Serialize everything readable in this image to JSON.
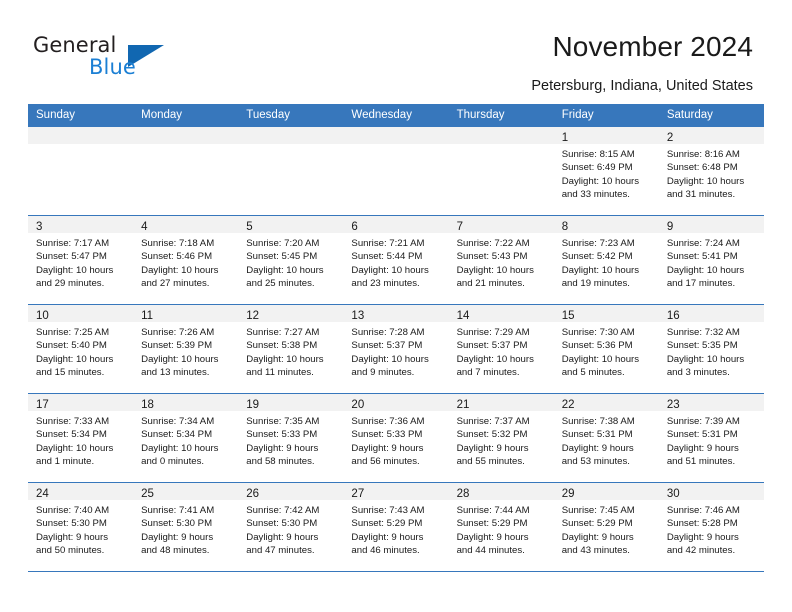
{
  "logo": {
    "word1": "General",
    "word2": "Blue",
    "triangle_color": "#1167b1",
    "blue_color": "#1b7fd4"
  },
  "header": {
    "title": "November 2024",
    "subtitle": "Petersburg, Indiana, United States"
  },
  "theme": {
    "header_blue": "#3777bc",
    "band_gray": "#f2f2f2",
    "text": "#1a1a1a"
  },
  "calendar": {
    "weekday_headers": [
      "Sunday",
      "Monday",
      "Tuesday",
      "Wednesday",
      "Thursday",
      "Friday",
      "Saturday"
    ],
    "labels": {
      "sunrise": "Sunrise:",
      "sunset": "Sunset:",
      "daylight": "Daylight:"
    },
    "weeks": [
      [
        {
          "day": "",
          "empty": true
        },
        {
          "day": "",
          "empty": true
        },
        {
          "day": "",
          "empty": true
        },
        {
          "day": "",
          "empty": true
        },
        {
          "day": "",
          "empty": true
        },
        {
          "day": "1",
          "sunrise": "Sunrise: 8:15 AM",
          "sunset": "Sunset: 6:49 PM",
          "daylight1": "Daylight: 10 hours",
          "daylight2": "and 33 minutes."
        },
        {
          "day": "2",
          "sunrise": "Sunrise: 8:16 AM",
          "sunset": "Sunset: 6:48 PM",
          "daylight1": "Daylight: 10 hours",
          "daylight2": "and 31 minutes."
        }
      ],
      [
        {
          "day": "3",
          "sunrise": "Sunrise: 7:17 AM",
          "sunset": "Sunset: 5:47 PM",
          "daylight1": "Daylight: 10 hours",
          "daylight2": "and 29 minutes."
        },
        {
          "day": "4",
          "sunrise": "Sunrise: 7:18 AM",
          "sunset": "Sunset: 5:46 PM",
          "daylight1": "Daylight: 10 hours",
          "daylight2": "and 27 minutes."
        },
        {
          "day": "5",
          "sunrise": "Sunrise: 7:20 AM",
          "sunset": "Sunset: 5:45 PM",
          "daylight1": "Daylight: 10 hours",
          "daylight2": "and 25 minutes."
        },
        {
          "day": "6",
          "sunrise": "Sunrise: 7:21 AM",
          "sunset": "Sunset: 5:44 PM",
          "daylight1": "Daylight: 10 hours",
          "daylight2": "and 23 minutes."
        },
        {
          "day": "7",
          "sunrise": "Sunrise: 7:22 AM",
          "sunset": "Sunset: 5:43 PM",
          "daylight1": "Daylight: 10 hours",
          "daylight2": "and 21 minutes."
        },
        {
          "day": "8",
          "sunrise": "Sunrise: 7:23 AM",
          "sunset": "Sunset: 5:42 PM",
          "daylight1": "Daylight: 10 hours",
          "daylight2": "and 19 minutes."
        },
        {
          "day": "9",
          "sunrise": "Sunrise: 7:24 AM",
          "sunset": "Sunset: 5:41 PM",
          "daylight1": "Daylight: 10 hours",
          "daylight2": "and 17 minutes."
        }
      ],
      [
        {
          "day": "10",
          "sunrise": "Sunrise: 7:25 AM",
          "sunset": "Sunset: 5:40 PM",
          "daylight1": "Daylight: 10 hours",
          "daylight2": "and 15 minutes."
        },
        {
          "day": "11",
          "sunrise": "Sunrise: 7:26 AM",
          "sunset": "Sunset: 5:39 PM",
          "daylight1": "Daylight: 10 hours",
          "daylight2": "and 13 minutes."
        },
        {
          "day": "12",
          "sunrise": "Sunrise: 7:27 AM",
          "sunset": "Sunset: 5:38 PM",
          "daylight1": "Daylight: 10 hours",
          "daylight2": "and 11 minutes."
        },
        {
          "day": "13",
          "sunrise": "Sunrise: 7:28 AM",
          "sunset": "Sunset: 5:37 PM",
          "daylight1": "Daylight: 10 hours",
          "daylight2": "and 9 minutes."
        },
        {
          "day": "14",
          "sunrise": "Sunrise: 7:29 AM",
          "sunset": "Sunset: 5:37 PM",
          "daylight1": "Daylight: 10 hours",
          "daylight2": "and 7 minutes."
        },
        {
          "day": "15",
          "sunrise": "Sunrise: 7:30 AM",
          "sunset": "Sunset: 5:36 PM",
          "daylight1": "Daylight: 10 hours",
          "daylight2": "and 5 minutes."
        },
        {
          "day": "16",
          "sunrise": "Sunrise: 7:32 AM",
          "sunset": "Sunset: 5:35 PM",
          "daylight1": "Daylight: 10 hours",
          "daylight2": "and 3 minutes."
        }
      ],
      [
        {
          "day": "17",
          "sunrise": "Sunrise: 7:33 AM",
          "sunset": "Sunset: 5:34 PM",
          "daylight1": "Daylight: 10 hours",
          "daylight2": "and 1 minute."
        },
        {
          "day": "18",
          "sunrise": "Sunrise: 7:34 AM",
          "sunset": "Sunset: 5:34 PM",
          "daylight1": "Daylight: 10 hours",
          "daylight2": "and 0 minutes."
        },
        {
          "day": "19",
          "sunrise": "Sunrise: 7:35 AM",
          "sunset": "Sunset: 5:33 PM",
          "daylight1": "Daylight: 9 hours",
          "daylight2": "and 58 minutes."
        },
        {
          "day": "20",
          "sunrise": "Sunrise: 7:36 AM",
          "sunset": "Sunset: 5:33 PM",
          "daylight1": "Daylight: 9 hours",
          "daylight2": "and 56 minutes."
        },
        {
          "day": "21",
          "sunrise": "Sunrise: 7:37 AM",
          "sunset": "Sunset: 5:32 PM",
          "daylight1": "Daylight: 9 hours",
          "daylight2": "and 55 minutes."
        },
        {
          "day": "22",
          "sunrise": "Sunrise: 7:38 AM",
          "sunset": "Sunset: 5:31 PM",
          "daylight1": "Daylight: 9 hours",
          "daylight2": "and 53 minutes."
        },
        {
          "day": "23",
          "sunrise": "Sunrise: 7:39 AM",
          "sunset": "Sunset: 5:31 PM",
          "daylight1": "Daylight: 9 hours",
          "daylight2": "and 51 minutes."
        }
      ],
      [
        {
          "day": "24",
          "sunrise": "Sunrise: 7:40 AM",
          "sunset": "Sunset: 5:30 PM",
          "daylight1": "Daylight: 9 hours",
          "daylight2": "and 50 minutes."
        },
        {
          "day": "25",
          "sunrise": "Sunrise: 7:41 AM",
          "sunset": "Sunset: 5:30 PM",
          "daylight1": "Daylight: 9 hours",
          "daylight2": "and 48 minutes."
        },
        {
          "day": "26",
          "sunrise": "Sunrise: 7:42 AM",
          "sunset": "Sunset: 5:30 PM",
          "daylight1": "Daylight: 9 hours",
          "daylight2": "and 47 minutes."
        },
        {
          "day": "27",
          "sunrise": "Sunrise: 7:43 AM",
          "sunset": "Sunset: 5:29 PM",
          "daylight1": "Daylight: 9 hours",
          "daylight2": "and 46 minutes."
        },
        {
          "day": "28",
          "sunrise": "Sunrise: 7:44 AM",
          "sunset": "Sunset: 5:29 PM",
          "daylight1": "Daylight: 9 hours",
          "daylight2": "and 44 minutes."
        },
        {
          "day": "29",
          "sunrise": "Sunrise: 7:45 AM",
          "sunset": "Sunset: 5:29 PM",
          "daylight1": "Daylight: 9 hours",
          "daylight2": "and 43 minutes."
        },
        {
          "day": "30",
          "sunrise": "Sunrise: 7:46 AM",
          "sunset": "Sunset: 5:28 PM",
          "daylight1": "Daylight: 9 hours",
          "daylight2": "and 42 minutes."
        }
      ]
    ]
  }
}
